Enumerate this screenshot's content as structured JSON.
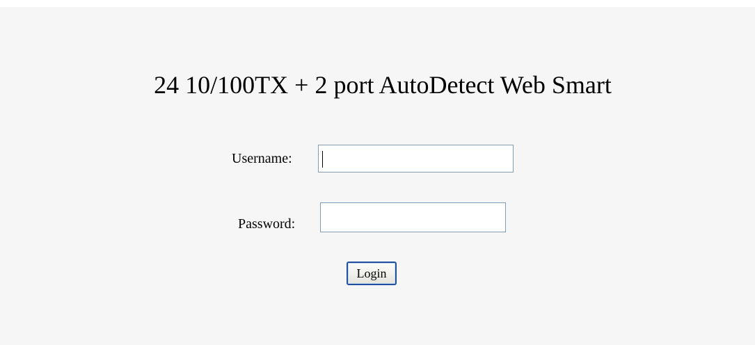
{
  "page": {
    "title": "24 10/100TX + 2 port AutoDetect Web Smart"
  },
  "form": {
    "username_label": "Username:",
    "username_value": "",
    "password_label": "Password:",
    "password_value": "",
    "login_label": "Login"
  },
  "colors": {
    "page_background": "#f6f6f6",
    "input_border": "#7f9db9",
    "button_border": "#2050a0"
  }
}
